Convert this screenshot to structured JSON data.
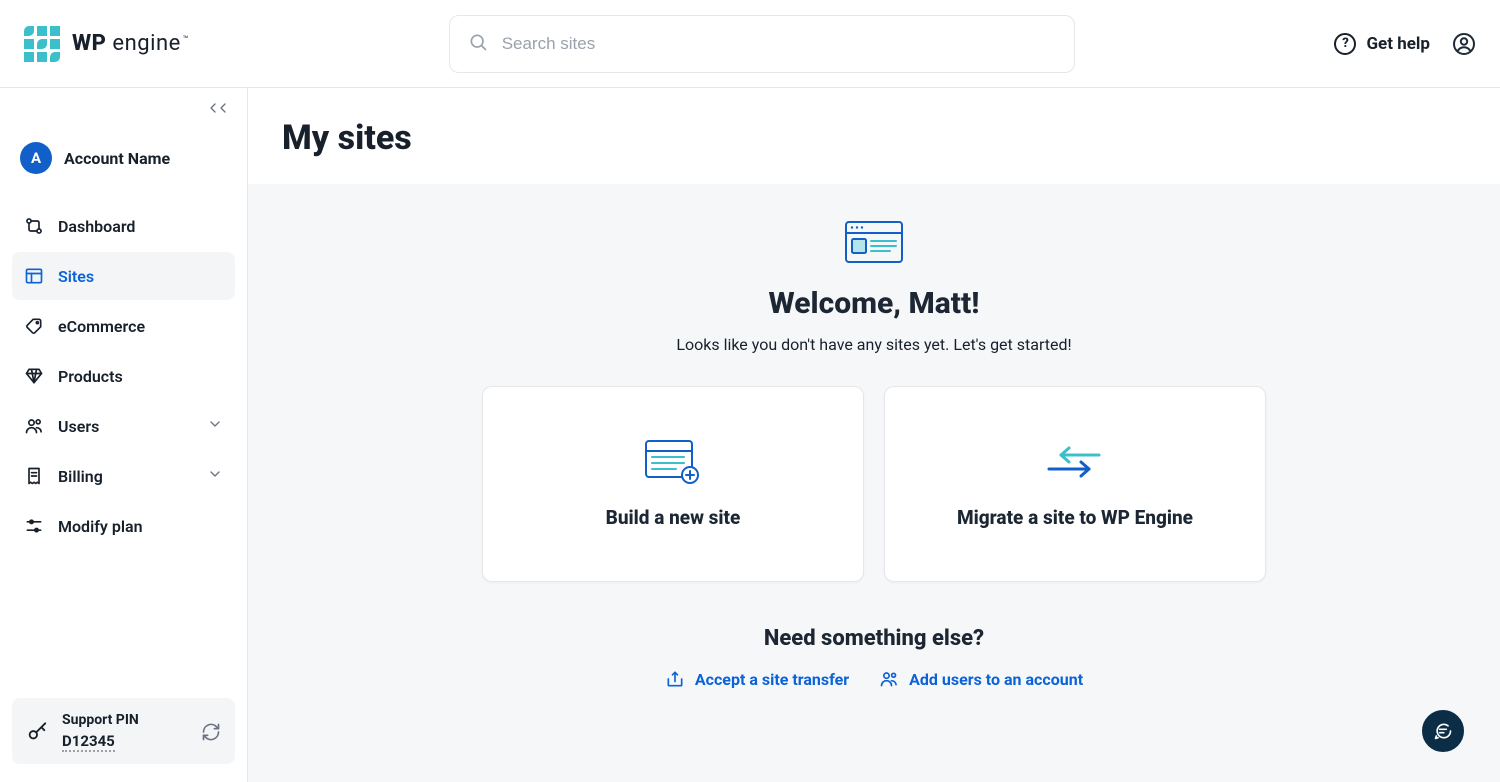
{
  "brand": {
    "bold": "WP",
    "light": "engine",
    "tm": "™"
  },
  "search": {
    "placeholder": "Search sites"
  },
  "header": {
    "get_help": "Get help"
  },
  "account": {
    "initial": "A",
    "name": "Account Name"
  },
  "sidebar": {
    "items": [
      {
        "label": "Dashboard"
      },
      {
        "label": "Sites"
      },
      {
        "label": "eCommerce"
      },
      {
        "label": "Products"
      },
      {
        "label": "Users"
      },
      {
        "label": "Billing"
      },
      {
        "label": "Modify plan"
      }
    ]
  },
  "support_pin": {
    "label": "Support PIN",
    "value": "D12345"
  },
  "page": {
    "title": "My sites"
  },
  "hero": {
    "title": "Welcome, Matt!",
    "subtitle": "Looks like you don't have any sites yet. Let's get started!"
  },
  "cards": {
    "build": "Build a new site",
    "migrate": "Migrate a site to WP Engine"
  },
  "something": {
    "title": "Need something else?",
    "accept_transfer": "Accept a site transfer",
    "add_users": "Add users to an account"
  }
}
